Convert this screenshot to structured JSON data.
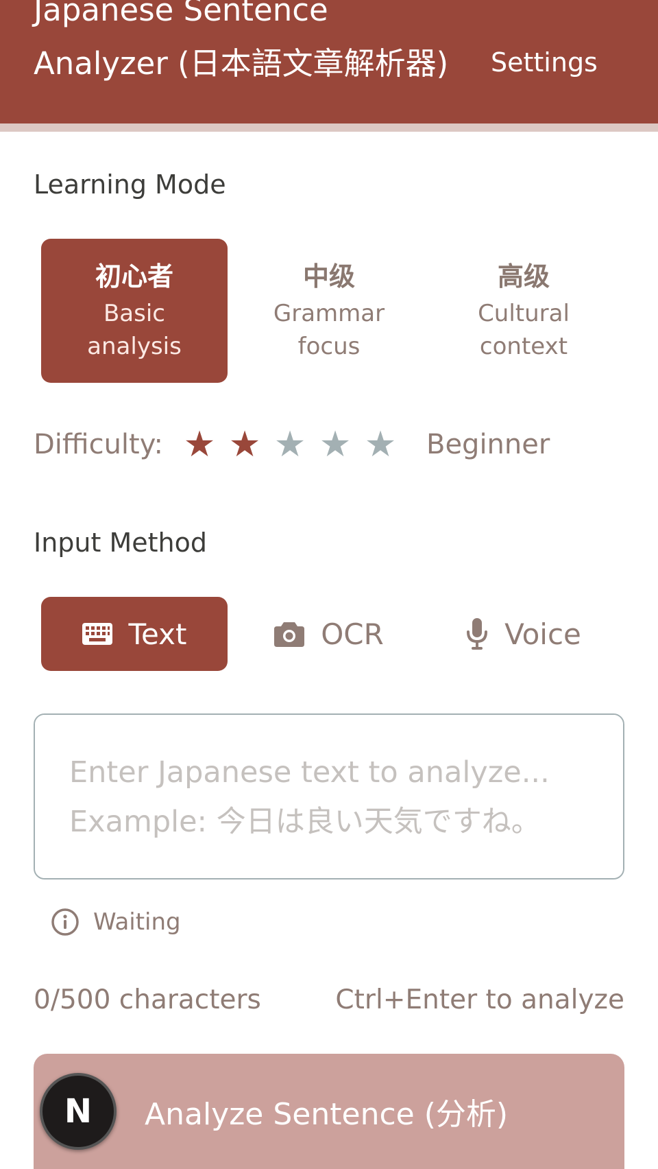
{
  "header": {
    "title": "Japanese Sentence Analyzer (日本語文章解析器)",
    "settings_label": "Settings"
  },
  "learning_mode": {
    "label": "Learning Mode",
    "options": [
      {
        "title": "初心者",
        "subtitle": "Basic analysis",
        "active": true
      },
      {
        "title": "中级",
        "subtitle": "Grammar focus",
        "active": false
      },
      {
        "title": "高级",
        "subtitle": "Cultural context",
        "active": false
      }
    ]
  },
  "difficulty": {
    "label": "Difficulty:",
    "rating": 2,
    "max": 5,
    "level_text": "Beginner",
    "filled_color": "#99473a",
    "empty_color": "#a3b0b3"
  },
  "input_method": {
    "label": "Input Method",
    "options": [
      {
        "label": "Text",
        "icon": "keyboard-icon",
        "active": true
      },
      {
        "label": "OCR",
        "icon": "camera-icon",
        "active": false
      },
      {
        "label": "Voice",
        "icon": "microphone-icon",
        "active": false
      }
    ]
  },
  "text_input": {
    "value": "",
    "placeholder": "Enter Japanese text to analyze...\nExample: 今日は良い天気ですね。"
  },
  "status": {
    "icon": "info-icon",
    "text": "Waiting"
  },
  "char_count": "0/500 characters",
  "shortcut_hint": "Ctrl+Enter to analyze",
  "analyze_button": {
    "label": "Analyze Sentence (分析)"
  },
  "badge": {
    "letter": "N"
  },
  "colors": {
    "brand": "#99473a",
    "brand_light": "#dcc8c3",
    "button_disabled": "#cca19c",
    "muted_text": "#8f7c75"
  }
}
